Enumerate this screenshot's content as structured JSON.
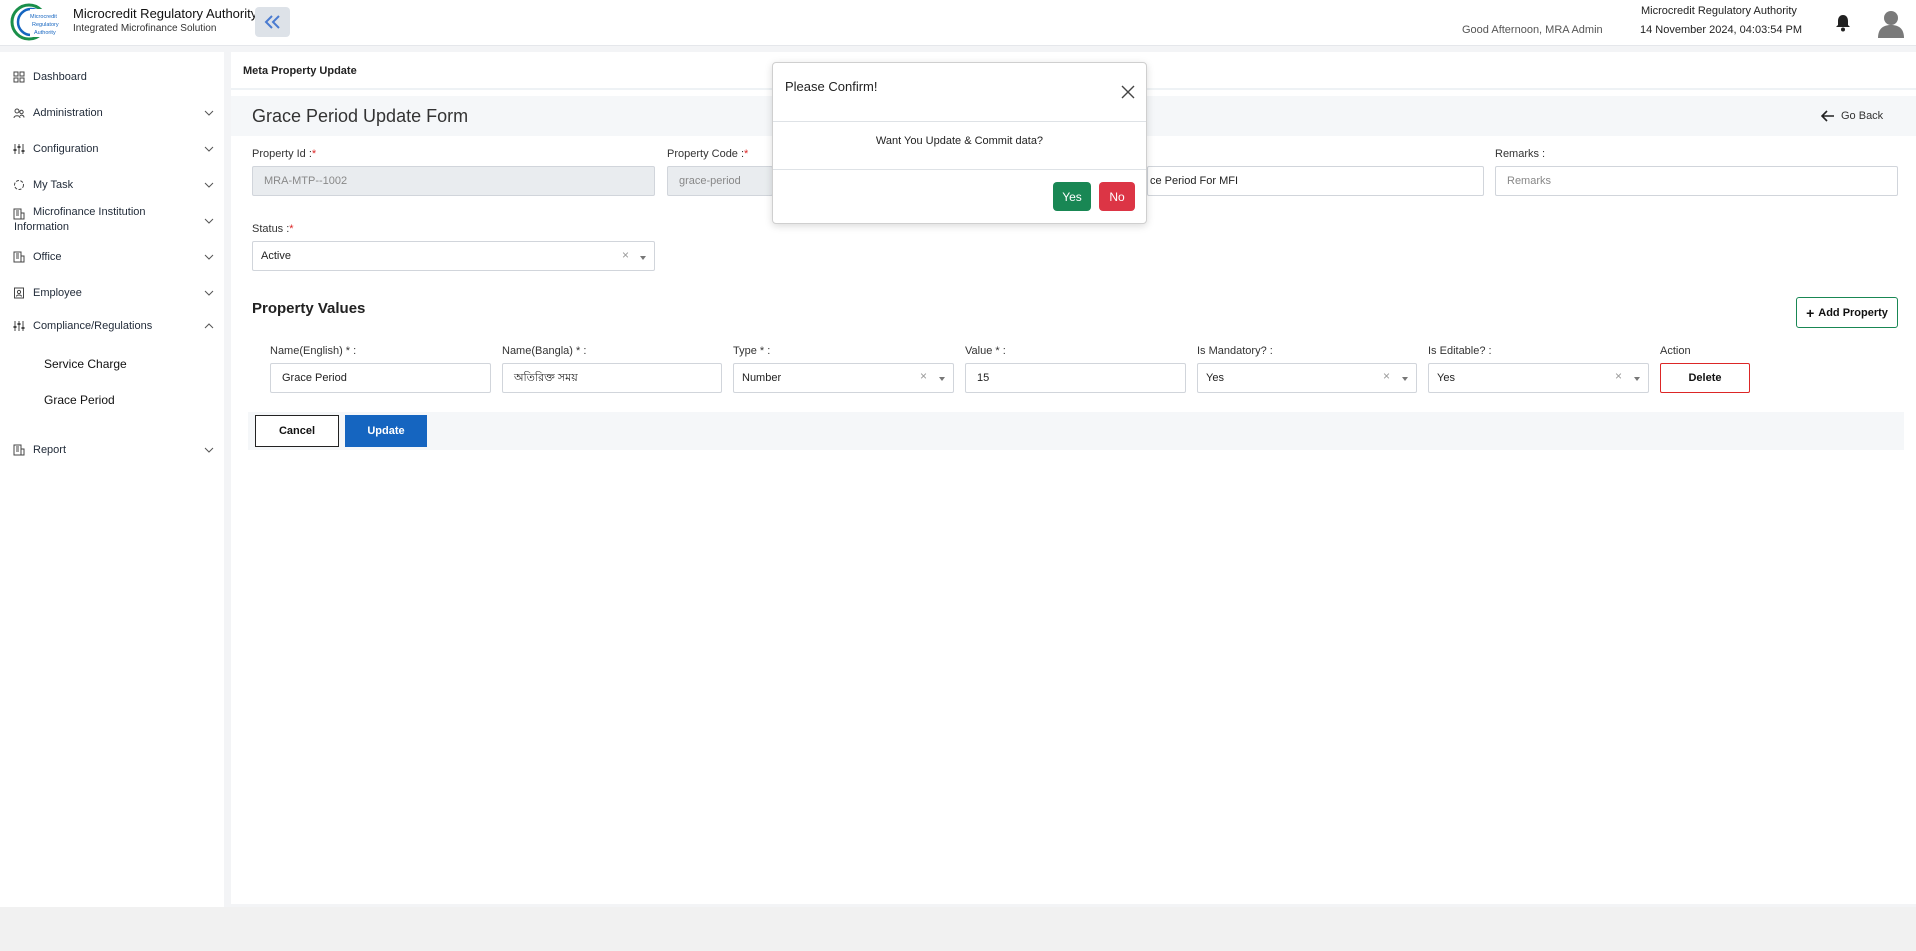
{
  "header": {
    "org_name": "Microcredit Regulatory Authority",
    "org_sub": "Integrated Microfinance Solution",
    "greeting": "Good Afternoon, MRA Admin",
    "org_right": "Microcredit Regulatory Authority",
    "datetime": "14 November 2024, 04:03:54 PM",
    "logo_text": [
      "Microcredit",
      "Regulatory",
      "Authority"
    ]
  },
  "sidebar": {
    "items": [
      {
        "label": "Dashboard",
        "icon": "dashboard-icon"
      },
      {
        "label": "Administration",
        "icon": "users-icon"
      },
      {
        "label": "Configuration",
        "icon": "sliders-icon"
      },
      {
        "label": "My Task",
        "icon": "task-icon"
      },
      {
        "label": "Microfinance Institution",
        "label2": "Information",
        "icon": "building-icon"
      },
      {
        "label": "Office",
        "icon": "office-icon"
      },
      {
        "label": "Employee",
        "icon": "employee-icon"
      },
      {
        "label": "Compliance/Regulations",
        "icon": "sliders-icon"
      },
      {
        "label": "Report",
        "icon": "report-icon"
      }
    ],
    "sub_items": [
      "Service Charge",
      "Grace Period"
    ]
  },
  "breadcrumb": "Meta Property Update",
  "form": {
    "title": "Grace Period Update Form",
    "go_back": "Go Back",
    "property_id": {
      "label": "Property Id :",
      "value": "MRA-MTP--1002"
    },
    "property_code": {
      "label": "Property Code :",
      "value": "grace-period"
    },
    "description_value": "ce Period For MFI",
    "remarks": {
      "label": "Remarks :",
      "placeholder": "Remarks"
    },
    "status": {
      "label": "Status :",
      "value": "Active"
    }
  },
  "property_values": {
    "title": "Property Values",
    "add_button": "Add Property",
    "columns": [
      "Name(English) * :",
      "Name(Bangla) * :",
      "Type * :",
      "Value * :",
      "Is Mandatory? :",
      "Is Editable? :",
      "Action"
    ],
    "row": {
      "name_en": "Grace Period",
      "name_bn": "অতিরিক্ত সময়",
      "type": "Number",
      "value": "15",
      "mandatory": "Yes",
      "editable": "Yes",
      "delete": "Delete"
    }
  },
  "actions": {
    "cancel": "Cancel",
    "update": "Update"
  },
  "modal": {
    "title": "Please Confirm!",
    "message": "Want You Update & Commit data?",
    "yes": "Yes",
    "no": "No"
  },
  "colors": {
    "accent": "#1565c0",
    "success": "#198754",
    "danger": "#dc3545"
  }
}
